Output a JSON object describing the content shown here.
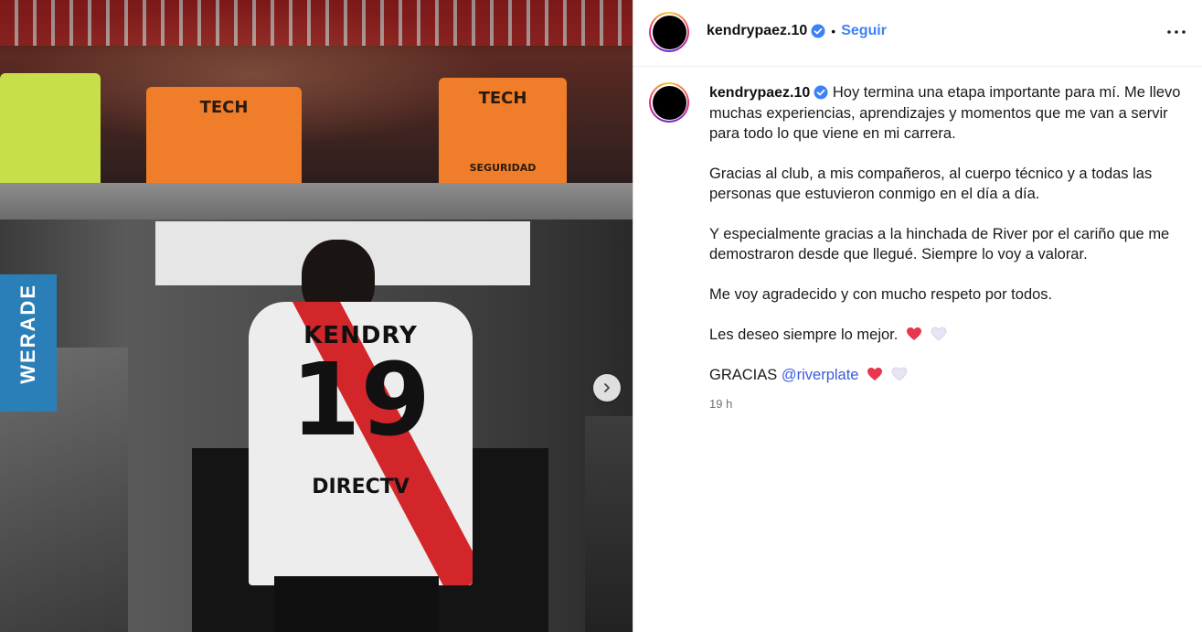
{
  "post": {
    "username": "kendrypaez.10",
    "follow_label": "Seguir",
    "separator": "•"
  },
  "photo": {
    "vest_text": "TECH",
    "vest_text_2": "SEGURIDAD",
    "shirt_name": "KENDRY",
    "shirt_number": "19",
    "shirt_sponsor": "DIRECTV",
    "board_text": "WERADE"
  },
  "caption": {
    "username": "kendrypaez.10",
    "para1": "Hoy termina una etapa importante para mí. Me llevo muchas experiencias, aprendizajes y momentos que me van a servir para todo lo que viene en mi carrera.",
    "para2": "Gracias al club, a mis compañeros, al cuerpo técnico y a todas las personas que estuvieron conmigo en el día a día.",
    "para3": "Y especialmente gracias a la hinchada de River por el cariño que me demostraron desde que llegué. Siempre lo voy a valorar.",
    "para4": "Me voy agradecido y con mucho respeto por todos.",
    "para5": "Les deseo siempre lo mejor.",
    "para6_prefix": "GRACIAS",
    "mention": "@riverplate",
    "time": "19 h"
  },
  "colors": {
    "accent_blue": "#3b82f6",
    "mention_blue": "#3b5bdb",
    "heart_red": "#e8364e",
    "heart_white": "#e9e4f4"
  },
  "icons": {
    "verified": "verified-badge-icon",
    "more": "more-horizontal-icon",
    "next": "chevron-right-icon",
    "heart_red": "red-heart-icon",
    "heart_white": "white-heart-icon"
  }
}
